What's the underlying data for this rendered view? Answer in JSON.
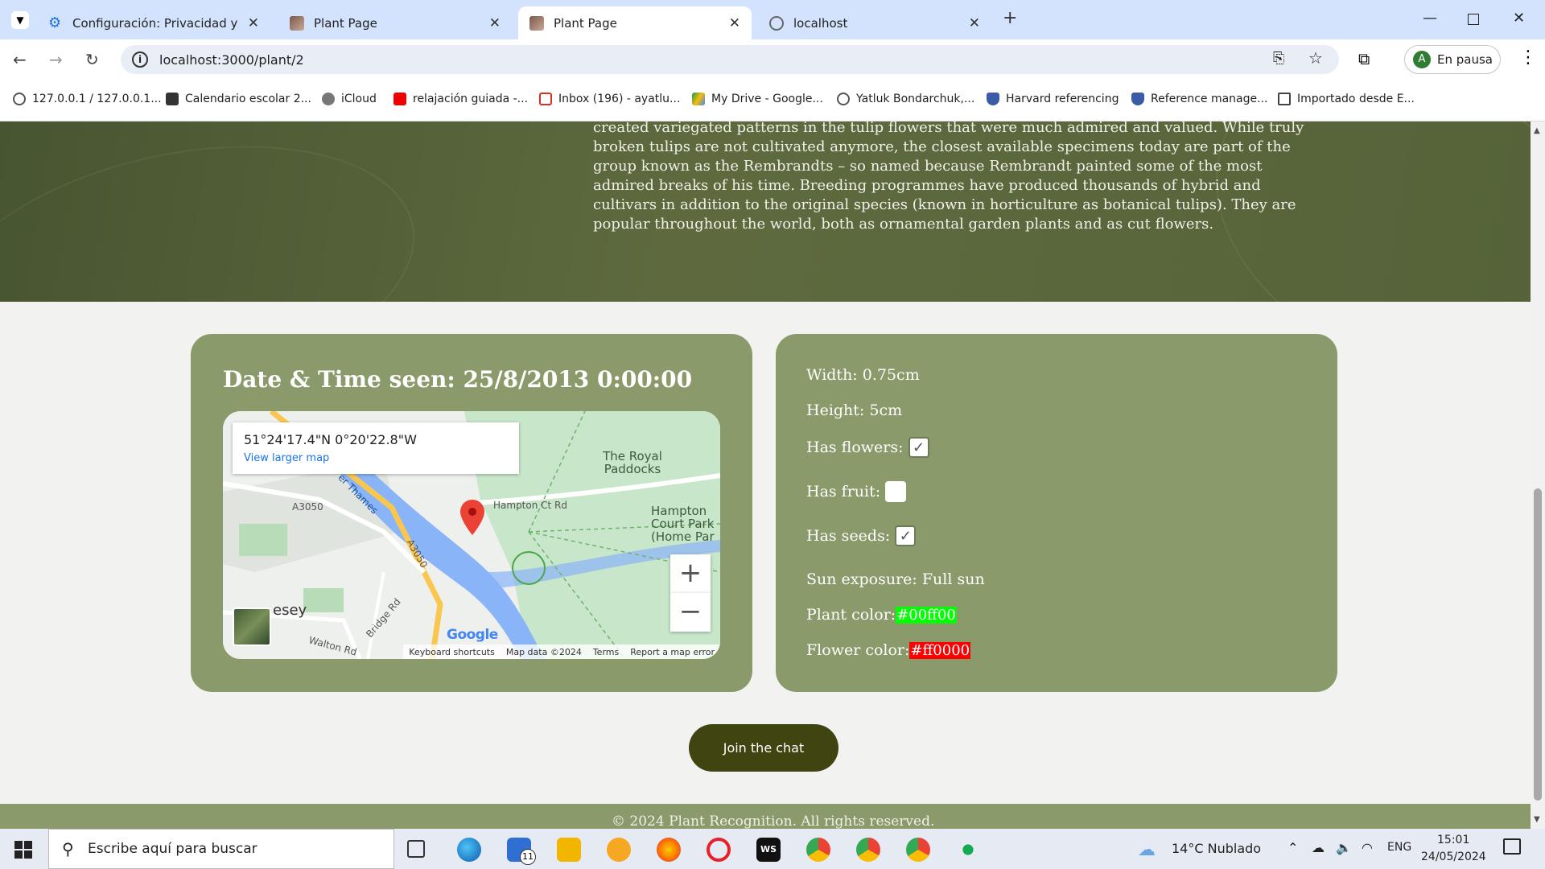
{
  "browser": {
    "tabs": [
      {
        "title": "Configuración: Privacidad y seg",
        "icon": "gear-icon"
      },
      {
        "title": "Plant Page",
        "icon": "plant-thumbnail-icon"
      },
      {
        "title": "Plant Page",
        "icon": "plant-thumbnail-icon"
      },
      {
        "title": "localhost",
        "icon": "globe-icon"
      }
    ],
    "new_tab": "+",
    "url": "localhost:3000/plant/2",
    "profile_label": "En pausa",
    "profile_initial": "A",
    "bookmarks": [
      {
        "label": "127.0.0.1 / 127.0.0.1...",
        "icon": "globe-icon"
      },
      {
        "label": "Calendario escolar 2...",
        "icon": "calendar-logo-icon"
      },
      {
        "label": "iCloud",
        "icon": "apple-icon"
      },
      {
        "label": "relajación guiada -...",
        "icon": "youtube-icon"
      },
      {
        "label": "Inbox (196) - ayatlu...",
        "icon": "gmail-icon"
      },
      {
        "label": "My Drive - Google...",
        "icon": "drive-icon"
      },
      {
        "label": "Yatluk Bondarchuk,...",
        "icon": "globe-icon"
      },
      {
        "label": "Harvard referencing",
        "icon": "shield-icon"
      },
      {
        "label": "Reference manage...",
        "icon": "shield-icon"
      },
      {
        "label": "Importado desde E...",
        "icon": "folder-icon"
      }
    ]
  },
  "hero": {
    "description": "created variegated patterns in the tulip flowers that were much admired and valued. While truly broken tulips are not cultivated anymore, the closest available specimens today are part of the group known as the Rembrandts – so named because Rembrandt painted some of the most admired breaks of his time. Breeding programmes have produced thousands of hybrid and cultivars in addition to the original species (known in horticulture as botanical tulips). They are popular throughout the world, both as ornamental garden plants and as cut flowers."
  },
  "sighting": {
    "title": "Date & Time seen: 25/8/2013 0:00:00",
    "map": {
      "coords": "51°24'17.4\"N 0°20'22.8\"W",
      "view_larger": "View larger map",
      "labels": {
        "royal_paddocks": "The Royal Paddocks",
        "hampton_court": "Hampton Court Park (Home Par",
        "molesey": "esey",
        "hampton_ct_rd": "Hampton Ct Rd",
        "a3050_top": "A3050",
        "a3050_mid": "A3050",
        "thames": "er Thames",
        "bridge_rd": "Bridge Rd",
        "walton_rd": "Walton Rd"
      },
      "zoom_in": "+",
      "zoom_out": "−",
      "google": "Google",
      "footer": [
        "Keyboard shortcuts",
        "Map data ©2024",
        "Terms",
        "Report a map error"
      ]
    }
  },
  "attributes": {
    "width": "Width: 0.75cm",
    "height": "Height: 5cm",
    "has_flowers": "Has flowers:",
    "has_flowers_checked": true,
    "has_fruit": "Has fruit:",
    "has_fruit_checked": false,
    "has_seeds": "Has seeds:",
    "has_seeds_checked": true,
    "sun_exposure": "Sun exposure: Full sun",
    "plant_color_label": "Plant color:",
    "plant_color": "#00ff00",
    "flower_color_label": "Flower color:",
    "flower_color": "#ff0000"
  },
  "chat_button": "Join the chat",
  "footer": "© 2024 Plant Recognition. All rights reserved.",
  "taskbar": {
    "search_placeholder": "Escribe aquí para buscar",
    "mail_badge": "11",
    "weather": "14°C  Nublado",
    "language": "ENG",
    "time": "15:01",
    "date": "24/05/2024"
  },
  "colors": {
    "card": "#8a9a6a",
    "hero": "#56633a",
    "chat_button": "#3f4410",
    "tab_strip": "#d3e3fd"
  }
}
